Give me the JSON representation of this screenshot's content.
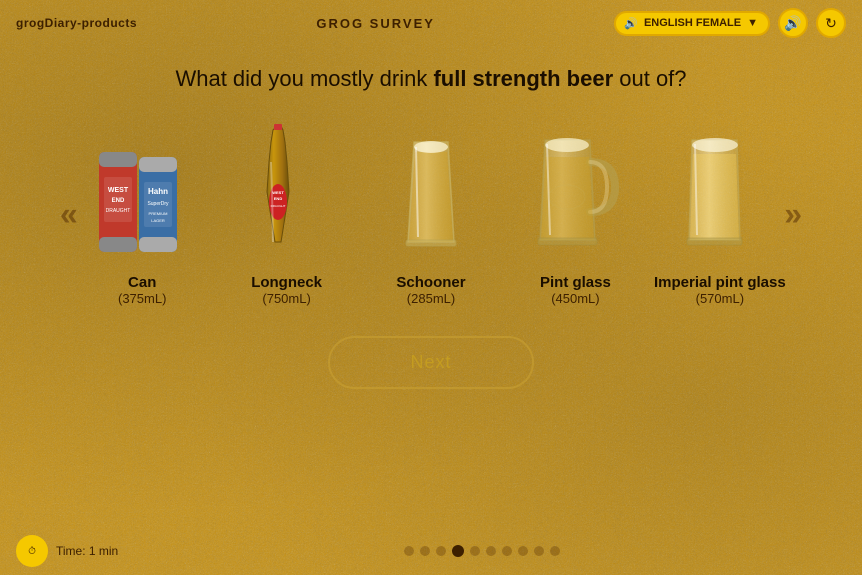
{
  "app": {
    "logo": "grogDiary-products",
    "survey_title": "GROG SURVEY"
  },
  "header": {
    "language_label": "ENGLISH FEMALE",
    "speaker_icon": "🔊",
    "dropdown_icon": "▼",
    "volume_icon": "🔊",
    "refresh_icon": "↻"
  },
  "question": {
    "prefix": "What did you mostly drink ",
    "highlight": "full strength beer",
    "suffix": " out of?"
  },
  "nav": {
    "left_arrow": "«",
    "right_arrow": "»"
  },
  "options": [
    {
      "id": "can",
      "label": "Can",
      "sublabel": "(375mL)",
      "image_type": "can"
    },
    {
      "id": "longneck",
      "label": "Longneck",
      "sublabel": "(750mL)",
      "image_type": "longneck"
    },
    {
      "id": "schooner",
      "label": "Schooner",
      "sublabel": "(285mL)",
      "image_type": "schooner"
    },
    {
      "id": "pint",
      "label": "Pint glass",
      "sublabel": "(450mL)",
      "image_type": "pint"
    },
    {
      "id": "imperial",
      "label": "Imperial pint glass",
      "sublabel": "(570mL)",
      "image_type": "imperial"
    }
  ],
  "next_button": {
    "label": "Next"
  },
  "footer": {
    "timer_label": "Time: 1 min",
    "dots_count": 10,
    "active_dot": 3
  }
}
